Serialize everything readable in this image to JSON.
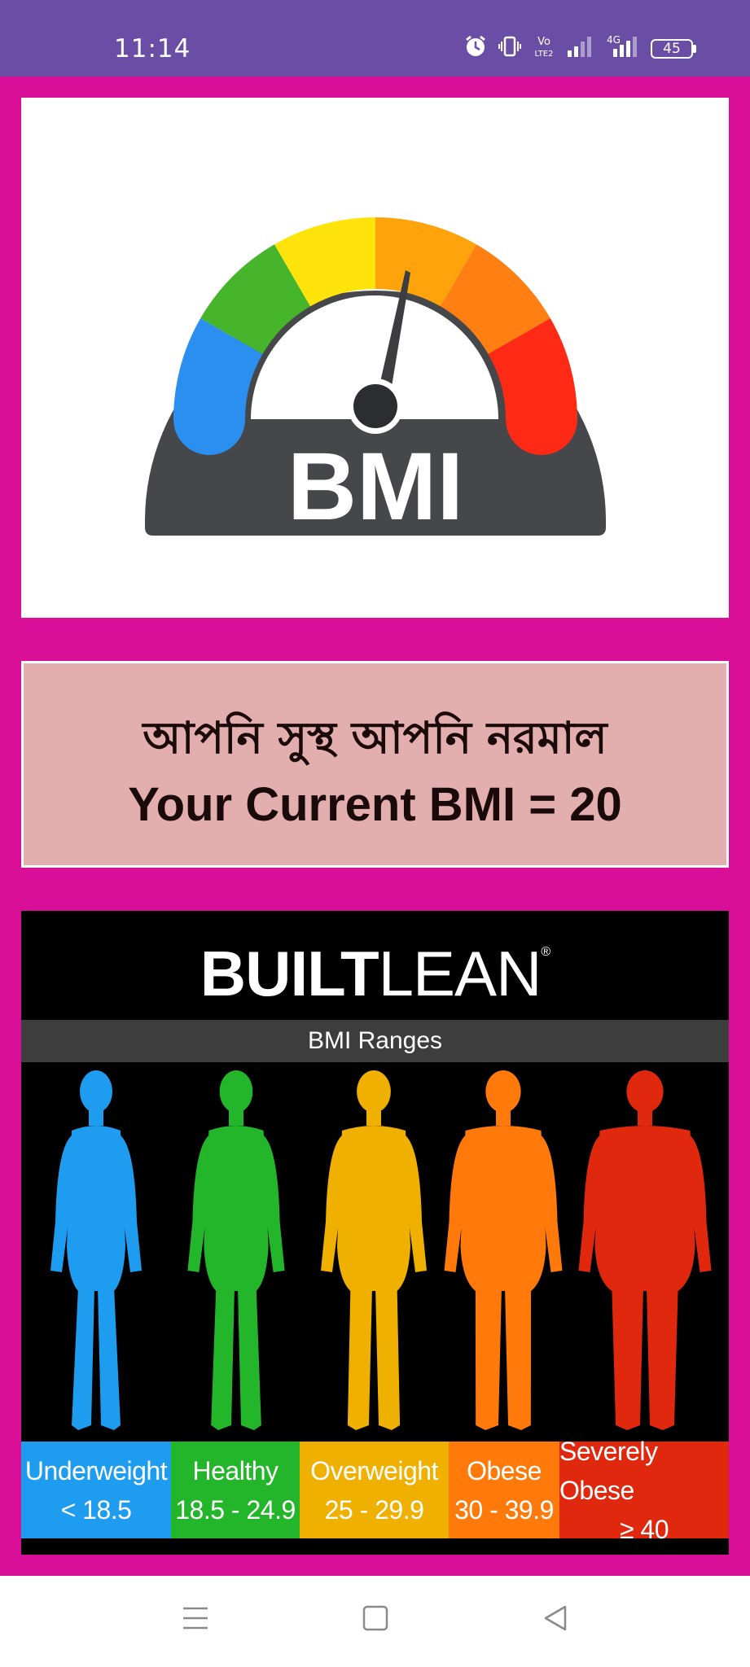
{
  "status_bar": {
    "time": "11:14",
    "battery": "45",
    "icons": [
      "alarm-icon",
      "vibrate-icon",
      "volte-icon",
      "signal-icon",
      "4g-signal-icon",
      "battery-icon"
    ],
    "network_label_top": "Vo",
    "network_label_bottom": "LTE2",
    "data_label": "4G"
  },
  "gauge_card": {
    "label": "BMI",
    "segment_colors": [
      "#2b8ff0",
      "#47b52c",
      "#ffe40b",
      "#ffa30c",
      "#ff7f12",
      "#ff2a15"
    ]
  },
  "result": {
    "status_text": "আপনি সুস্থ আপনি নরমাল",
    "bmi_text": "Your Current BMI = 20"
  },
  "ranges_card": {
    "brand_bold": "BUILT",
    "brand_light": "LEAN",
    "brand_mark": "®",
    "header": "BMI Ranges",
    "categories": [
      {
        "name": "Underweight",
        "range": "< 18.5",
        "color": "#1e9cf0"
      },
      {
        "name": "Healthy",
        "range": "18.5 - 24.9",
        "color": "#23b52a"
      },
      {
        "name": "Overweight",
        "range": "25 - 29.9",
        "color": "#f0b000"
      },
      {
        "name": "Obese",
        "range": "30 - 39.9",
        "color": "#ff7a0a"
      },
      {
        "name": "Severely Obese",
        "range": "≥ 40",
        "color": "#e0280e"
      }
    ]
  },
  "nav_bar": {
    "icons": [
      "menu-icon",
      "home-icon",
      "back-icon"
    ]
  }
}
